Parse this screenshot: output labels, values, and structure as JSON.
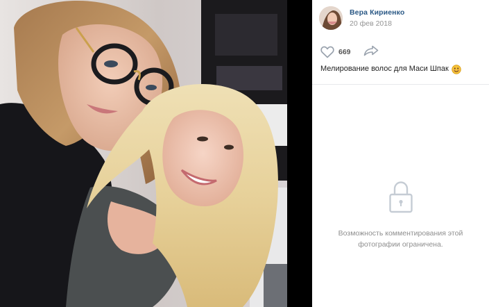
{
  "post": {
    "author_name": "Вера Кириенко",
    "date": "20 фев 2018",
    "likes_count": "669",
    "caption": "Мелирование волос для Маси Шпак",
    "caption_emoji": "smiling-face-emoji"
  },
  "comments": {
    "restricted_line1": "Возможность комментирования этой",
    "restricted_line2": "фотографии ограничена."
  },
  "icons": {
    "like": "heart-icon",
    "share": "share-arrow-icon",
    "lock": "lock-icon"
  },
  "colors": {
    "author_link": "#2a5885",
    "muted_text": "#939393",
    "icon_gray": "#aeb7c2",
    "emoji_yellow": "#f6c33a"
  }
}
